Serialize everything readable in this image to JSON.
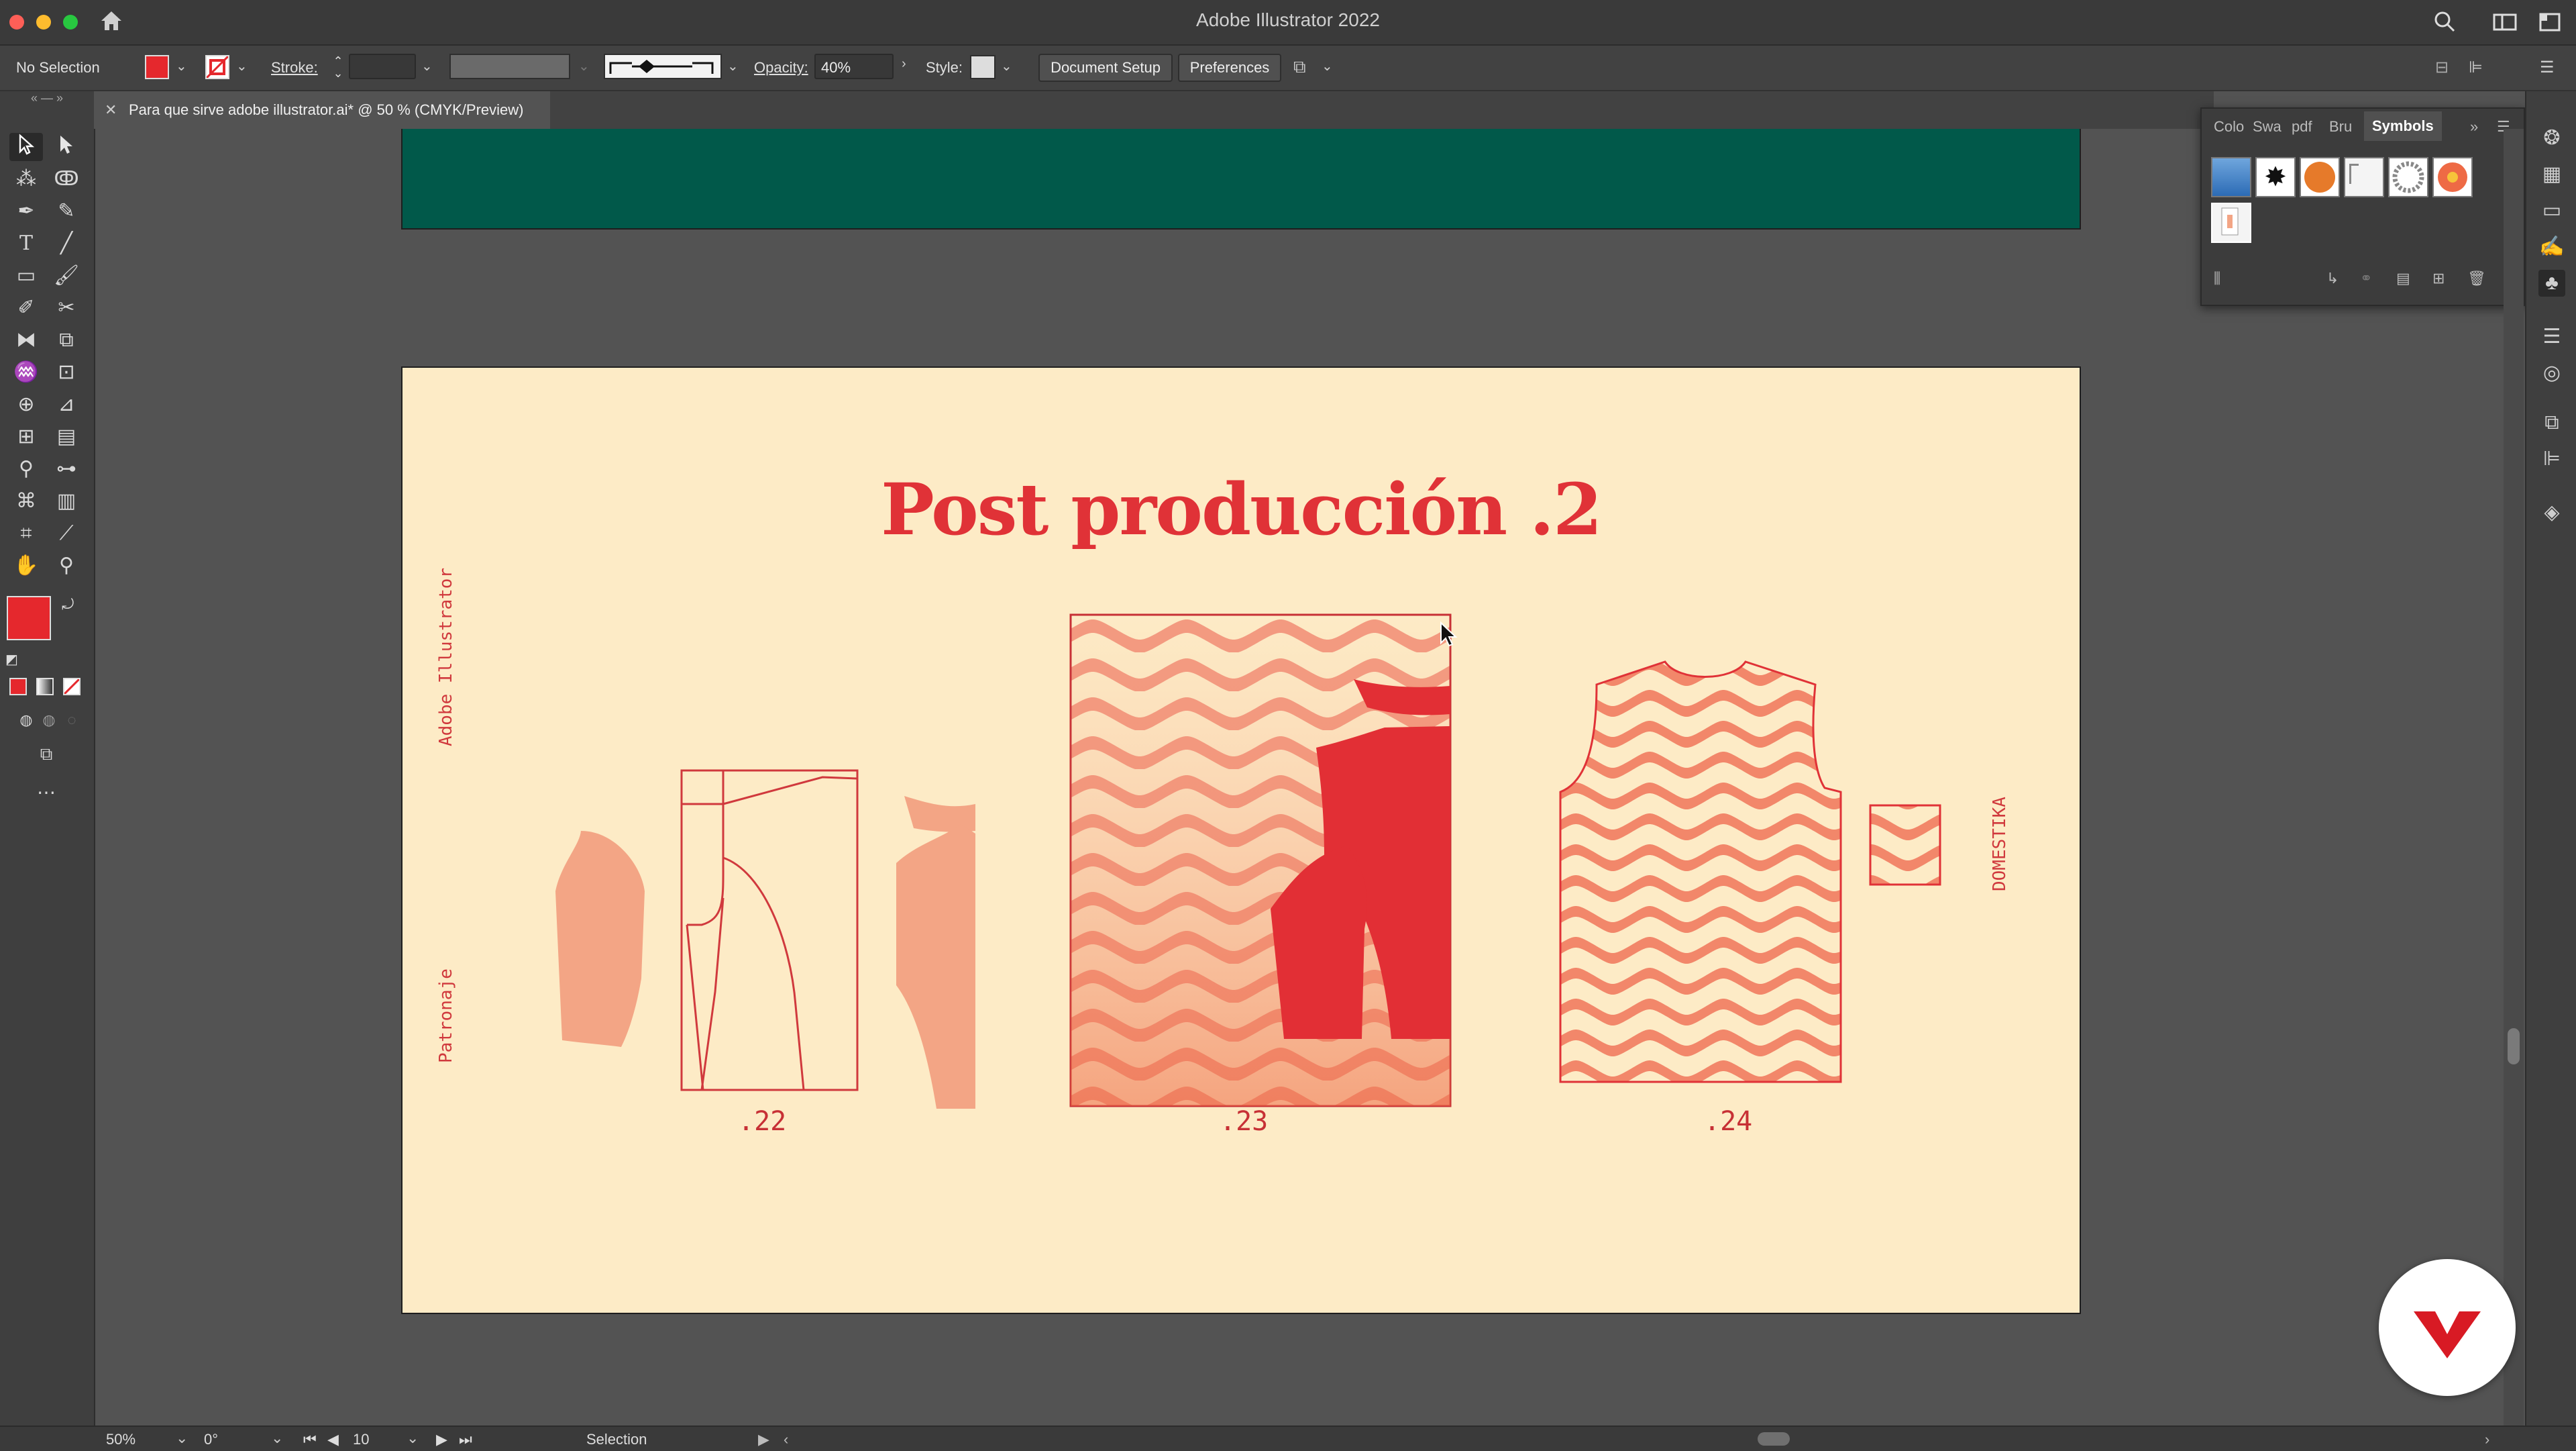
{
  "app": {
    "title": "Adobe Illustrator 2022"
  },
  "control_bar": {
    "selection_label": "No Selection",
    "stroke_label": "Stroke:",
    "opacity_label": "Opacity:",
    "opacity_value": "40%",
    "style_label": "Style:",
    "document_setup": "Document Setup",
    "preferences": "Preferences",
    "fill_color": "#e5282d"
  },
  "document_tab": {
    "title": "Para que sirve adobe illustrator.ai* @ 50 % (CMYK/Preview)"
  },
  "panel": {
    "tabs": [
      "Colo",
      "Swa",
      "pdf",
      "Bru",
      "Symbols"
    ],
    "active_tab": "Symbols",
    "symbols": [
      "blue-gradient-symbol",
      "black-splatter-symbol",
      "orange-sphere-symbol",
      "document-symbol",
      "ring-symbol",
      "flower-symbol",
      "page-symbol"
    ]
  },
  "artboard": {
    "title": "Post producción .2",
    "left_label_top": "Adobe Illustrator",
    "left_label_bottom": "Patronaje",
    "right_label": "DOMESTIKA",
    "figures": [
      ".22",
      ".23",
      ".24"
    ],
    "colors": {
      "background": "#fdebc6",
      "red": "#e03237",
      "salmon": "#f3a585",
      "wave_light": "#f39a80",
      "wave_dark": "#ee6a45",
      "band": "#01594a"
    }
  },
  "status_bar": {
    "zoom": "50%",
    "rotation": "0°",
    "artboard_number": "10",
    "tool": "Selection"
  }
}
